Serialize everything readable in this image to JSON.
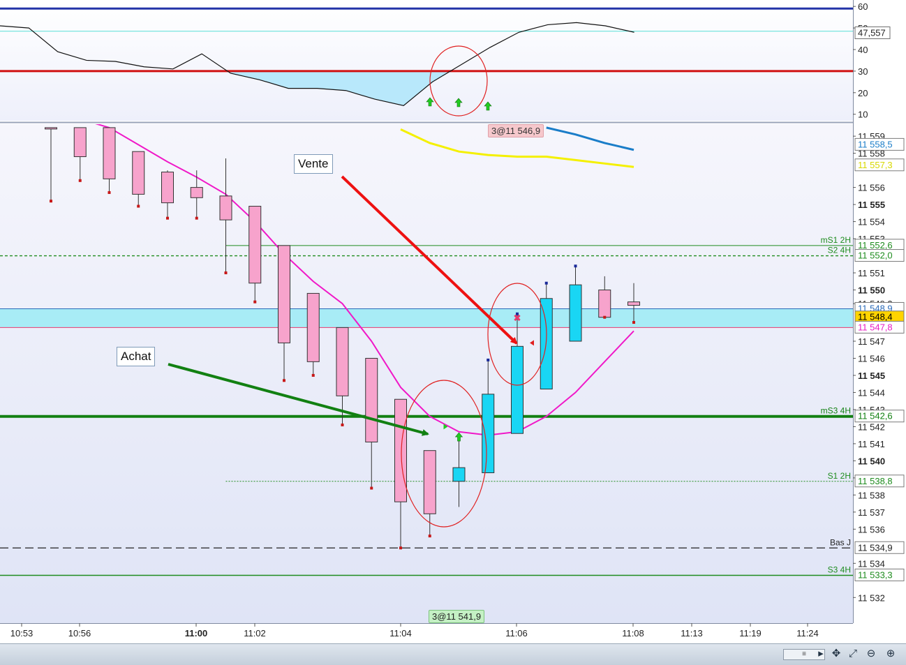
{
  "chart_data": {
    "type": "candlestick",
    "oscillator": {
      "y_ticks": [
        "60",
        "50",
        "40",
        "30",
        "20",
        "10"
      ],
      "ylim": [
        7,
        62
      ],
      "upper_level": 59,
      "lower_level": 30,
      "cyan_level": 48.5,
      "current_value_label": "47,557",
      "values": [
        51,
        50,
        39,
        35,
        34.5,
        32,
        31,
        38,
        29,
        26,
        22,
        22,
        21,
        17,
        14,
        25,
        33,
        41,
        48,
        51.5,
        52.5,
        51,
        48
      ]
    },
    "price_axis": {
      "ylim": [
        11530.5,
        11559.7
      ],
      "ticks": [
        {
          "value": 11559,
          "label": "11 559",
          "bold": false
        },
        {
          "value": 11558,
          "label": "11 558",
          "bold": false
        },
        {
          "value": 11556,
          "label": "11 556",
          "bold": false
        },
        {
          "value": 11555,
          "label": "11 555",
          "bold": true
        },
        {
          "value": 11554,
          "label": "11 554",
          "bold": false
        },
        {
          "value": 11553,
          "label": "11 553",
          "bold": false
        },
        {
          "value": 11551,
          "label": "11 551",
          "bold": false
        },
        {
          "value": 11550,
          "label": "11 550",
          "bold": true
        },
        {
          "value": 11549.2,
          "label": "11 549,2",
          "bold": false
        },
        {
          "value": 11547,
          "label": "11 547",
          "bold": false
        },
        {
          "value": 11546,
          "label": "11 546",
          "bold": false
        },
        {
          "value": 11545,
          "label": "11 545",
          "bold": true
        },
        {
          "value": 11544,
          "label": "11 544",
          "bold": false
        },
        {
          "value": 11543,
          "label": "11 543",
          "bold": false
        },
        {
          "value": 11542,
          "label": "11 542",
          "bold": false
        },
        {
          "value": 11541,
          "label": "11 541",
          "bold": false
        },
        {
          "value": 11540,
          "label": "11 540",
          "bold": true
        },
        {
          "value": 11539,
          "label": "11 539",
          "bold": false
        },
        {
          "value": 11538,
          "label": "11 538",
          "bold": false
        },
        {
          "value": 11537,
          "label": "11 537",
          "bold": false
        },
        {
          "value": 11536,
          "label": "11 536",
          "bold": false
        },
        {
          "value": 11534,
          "label": "11 534",
          "bold": false
        },
        {
          "value": 11532,
          "label": "11 532",
          "bold": false
        }
      ]
    },
    "x_labels": [
      "10:53",
      "10:56",
      "11:00",
      "11:02",
      "11:04",
      "11:06",
      "11:08",
      "11:13",
      "11:19",
      "11:24"
    ],
    "x_bold_label": "11:00",
    "candles": [
      {
        "o": 11559.5,
        "h": 11559.5,
        "l": 11555.2,
        "c": 11559.5,
        "dir": "down"
      },
      {
        "o": 11559.5,
        "h": 11559.5,
        "l": 11556.4,
        "c": 11557.8,
        "dir": "down"
      },
      {
        "o": 11559.5,
        "h": 11559.5,
        "l": 11555.7,
        "c": 11556.5,
        "dir": "down"
      },
      {
        "o": 11558.1,
        "h": 11558.1,
        "l": 11554.9,
        "c": 11555.6,
        "dir": "down"
      },
      {
        "o": 11556.9,
        "h": 11557.0,
        "l": 11554.2,
        "c": 11555.1,
        "dir": "down"
      },
      {
        "o": 11556.0,
        "h": 11557.0,
        "l": 11554.2,
        "c": 11555.4,
        "dir": "down"
      },
      {
        "o": 11555.5,
        "h": 11557.7,
        "l": 11551.0,
        "c": 11554.1,
        "dir": "down"
      },
      {
        "o": 11554.9,
        "h": 11554.9,
        "l": 11549.3,
        "c": 11550.4,
        "dir": "down"
      },
      {
        "o": 11552.6,
        "h": 11552.6,
        "l": 11544.7,
        "c": 11546.9,
        "dir": "down"
      },
      {
        "o": 11549.8,
        "h": 11549.8,
        "l": 11545.0,
        "c": 11545.8,
        "dir": "down"
      },
      {
        "o": 11547.8,
        "h": 11547.8,
        "l": 11542.1,
        "c": 11543.8,
        "dir": "down"
      },
      {
        "o": 11546.0,
        "h": 11546.0,
        "l": 11538.4,
        "c": 11541.1,
        "dir": "down"
      },
      {
        "o": 11543.6,
        "h": 11543.6,
        "l": 11534.9,
        "c": 11537.6,
        "dir": "down"
      },
      {
        "o": 11540.6,
        "h": 11540.6,
        "l": 11535.6,
        "c": 11536.9,
        "dir": "down"
      },
      {
        "o": 11538.8,
        "h": 11541.5,
        "l": 11537.3,
        "c": 11539.6,
        "dir": "up"
      },
      {
        "o": 11539.3,
        "h": 11545.9,
        "l": 11539.3,
        "c": 11543.9,
        "dir": "up"
      },
      {
        "o": 11541.6,
        "h": 11548.6,
        "l": 11541.6,
        "c": 11546.7,
        "dir": "up"
      },
      {
        "o": 11544.2,
        "h": 11550.4,
        "l": 11544.2,
        "c": 11549.5,
        "dir": "up"
      },
      {
        "o": 11547.0,
        "h": 11551.4,
        "l": 11547.0,
        "c": 11550.3,
        "dir": "up"
      },
      {
        "o": 11548.4,
        "h": 11550.8,
        "l": 11548.4,
        "c": 11550.0,
        "dir": "down"
      },
      {
        "o": 11549.3,
        "h": 11550.4,
        "l": 11548.1,
        "c": 11549.1,
        "dir": "down"
      }
    ],
    "ma_pink": [
      11560.5,
      11560.0,
      11559.5,
      11558.5,
      11557.5,
      11556.6,
      11555.6,
      11554.0,
      11552.1,
      11550.5,
      11549.2,
      11547.0,
      11544.3,
      11542.6,
      11541.7,
      11541.5,
      11541.7,
      11542.6,
      11544.0,
      11545.8,
      11547.6
    ],
    "ma_yellow": [
      11559.4,
      11558.6,
      11558.1,
      11557.9,
      11557.8,
      11557.8,
      11557.6,
      11557.4,
      11557.2
    ],
    "ma_blue": [
      11559.5,
      11559.1,
      11558.6,
      11558.2
    ],
    "levels": [
      {
        "name": "mS1 2H",
        "value": 11552.6,
        "label": "11 552,6",
        "color": "#1e8c1e",
        "style": "solid-thin",
        "from_index": 6
      },
      {
        "name": "S2 4H",
        "value": 11552.0,
        "label": "11 552,0",
        "color": "#1e8c1e",
        "style": "dashed"
      },
      {
        "name": "mS3 4H",
        "value": 11542.6,
        "label": "11 542,6",
        "color": "#128012",
        "style": "solid-thick"
      },
      {
        "name": "S1 2H",
        "value": 11538.8,
        "label": "11 538,8",
        "color": "#1e8c1e",
        "style": "dotted",
        "from_index": 6
      },
      {
        "name": "Bas J",
        "value": 11534.9,
        "label": "11 534,9",
        "color": "#222222",
        "style": "dashed-black"
      },
      {
        "name": "S3 4H",
        "value": 11533.3,
        "label": "11 533,3",
        "color": "#1e8c1e",
        "style": "solid"
      }
    ],
    "price_badges": [
      {
        "value": 11558.5,
        "label": "11 558,5",
        "color": "#1a7dc8",
        "bg": "#ffffff"
      },
      {
        "value": 11557.3,
        "label": "11 557,3",
        "color": "#d8d800",
        "bg": "#ffffff"
      },
      {
        "value": 11548.9,
        "label": "11 548,9",
        "color": "#2a6ab8",
        "bg": "#ffffff"
      },
      {
        "value": 11548.4,
        "label": "11 548,4",
        "color": "#000000",
        "bg": "#ffd400"
      },
      {
        "value": 11547.8,
        "label": "11 547,8",
        "color": "#e81cc4",
        "bg": "#ffffff"
      }
    ],
    "band": {
      "from": 11547.8,
      "to": 11548.9,
      "color": "#a8ecf6"
    },
    "annotations": {
      "vente": "Vente",
      "achat": "Achat",
      "sell_trade": "3@11 546,9",
      "buy_trade": "3@11 541,9"
    },
    "colors": {
      "down": "#f7a3cc",
      "up": "#19d6f4",
      "ma_pink": "#f018c8",
      "ma_yellow": "#f4f000",
      "ma_blue": "#1a7dc8",
      "osc_line": "#111111",
      "osc_fill": "#b8e8fb",
      "osc_upper": "#2434a8",
      "osc_lower": "#d01010",
      "osc_cyan": "#56dfd6"
    }
  },
  "toolbar": {
    "scroll_label": "≡",
    "tool_icons": [
      "move-icon",
      "zoom-fit-icon",
      "zoom-out-icon",
      "zoom-in-icon"
    ]
  }
}
